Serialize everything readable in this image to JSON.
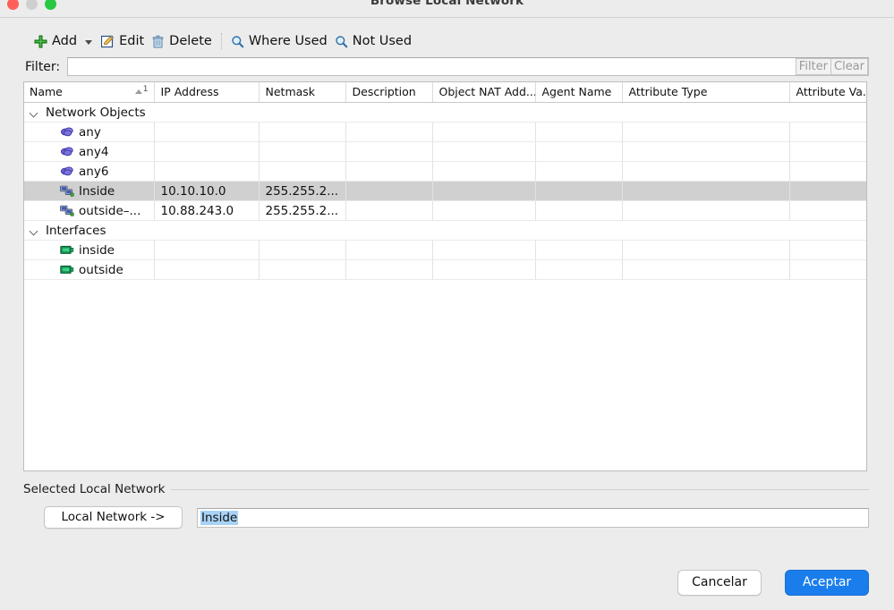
{
  "window": {
    "title": "Browse Local Network",
    "controls": [
      {
        "name": "close",
        "color": "#ff5f57"
      },
      {
        "name": "minimize",
        "color": "#cfcfcf"
      },
      {
        "name": "zoom",
        "color": "#28c840"
      }
    ]
  },
  "toolbar": {
    "add_label": "Add",
    "edit_label": "Edit",
    "delete_label": "Delete",
    "where_used_label": "Where Used",
    "not_used_label": "Not Used",
    "icons": {
      "add": "green-plus-icon",
      "add_dropdown": "chevron-down-icon",
      "edit": "pencil-edit-icon",
      "delete": "trash-icon",
      "where_used": "magnifier-icon",
      "not_used": "magnifier-icon"
    }
  },
  "filter": {
    "label": "Filter:",
    "value": "",
    "placeholder": "",
    "filter_button": "Filter",
    "clear_button": "Clear",
    "buttons_disabled": true
  },
  "table": {
    "columns": [
      "Name",
      "IP Address",
      "Netmask",
      "Description",
      "Object NAT Add...",
      "Agent Name",
      "Attribute Type",
      "Attribute Va..."
    ],
    "sort": {
      "column": "Name",
      "direction": "ascending",
      "order_index": "1"
    },
    "groups": [
      {
        "label": "Network Objects",
        "expanded": true,
        "icon": "chevron-down-icon",
        "rows": [
          {
            "icon": "network-any-icon",
            "name": "any",
            "ip": "",
            "netmask": "",
            "description": "",
            "object_nat": "",
            "agent_name": "",
            "attribute_type": "",
            "attribute_value": "",
            "selected": false
          },
          {
            "icon": "network-any-icon",
            "name": "any4",
            "ip": "",
            "netmask": "",
            "description": "",
            "object_nat": "",
            "agent_name": "",
            "attribute_type": "",
            "attribute_value": "",
            "selected": false
          },
          {
            "icon": "network-any-icon",
            "name": "any6",
            "ip": "",
            "netmask": "",
            "description": "",
            "object_nat": "",
            "agent_name": "",
            "attribute_type": "",
            "attribute_value": "",
            "selected": false
          },
          {
            "icon": "network-object-icon",
            "name": "Inside",
            "ip": "10.10.10.0",
            "netmask": "255.255.2...",
            "description": "",
            "object_nat": "",
            "agent_name": "",
            "attribute_type": "",
            "attribute_value": "",
            "selected": true
          },
          {
            "icon": "network-object-icon",
            "name": "outside–...",
            "ip": "10.88.243.0",
            "netmask": "255.255.2...",
            "description": "",
            "object_nat": "",
            "agent_name": "",
            "attribute_type": "",
            "attribute_value": "",
            "selected": false
          }
        ]
      },
      {
        "label": "Interfaces",
        "expanded": true,
        "icon": "chevron-down-icon",
        "rows": [
          {
            "icon": "interface-icon",
            "name": "inside",
            "ip": "",
            "netmask": "",
            "description": "",
            "object_nat": "",
            "agent_name": "",
            "attribute_type": "",
            "attribute_value": "",
            "selected": false
          },
          {
            "icon": "interface-icon",
            "name": "outside",
            "ip": "",
            "netmask": "",
            "description": "",
            "object_nat": "",
            "agent_name": "",
            "attribute_type": "",
            "attribute_value": "",
            "selected": false
          }
        ]
      }
    ]
  },
  "selected_section": {
    "title": "Selected Local Network",
    "assign_button": "Local Network ->",
    "value": "Inside",
    "value_highlighted": true
  },
  "footer": {
    "cancel_label": "Cancelar",
    "accept_label": "Aceptar",
    "accent_color": "#1a7dec"
  }
}
